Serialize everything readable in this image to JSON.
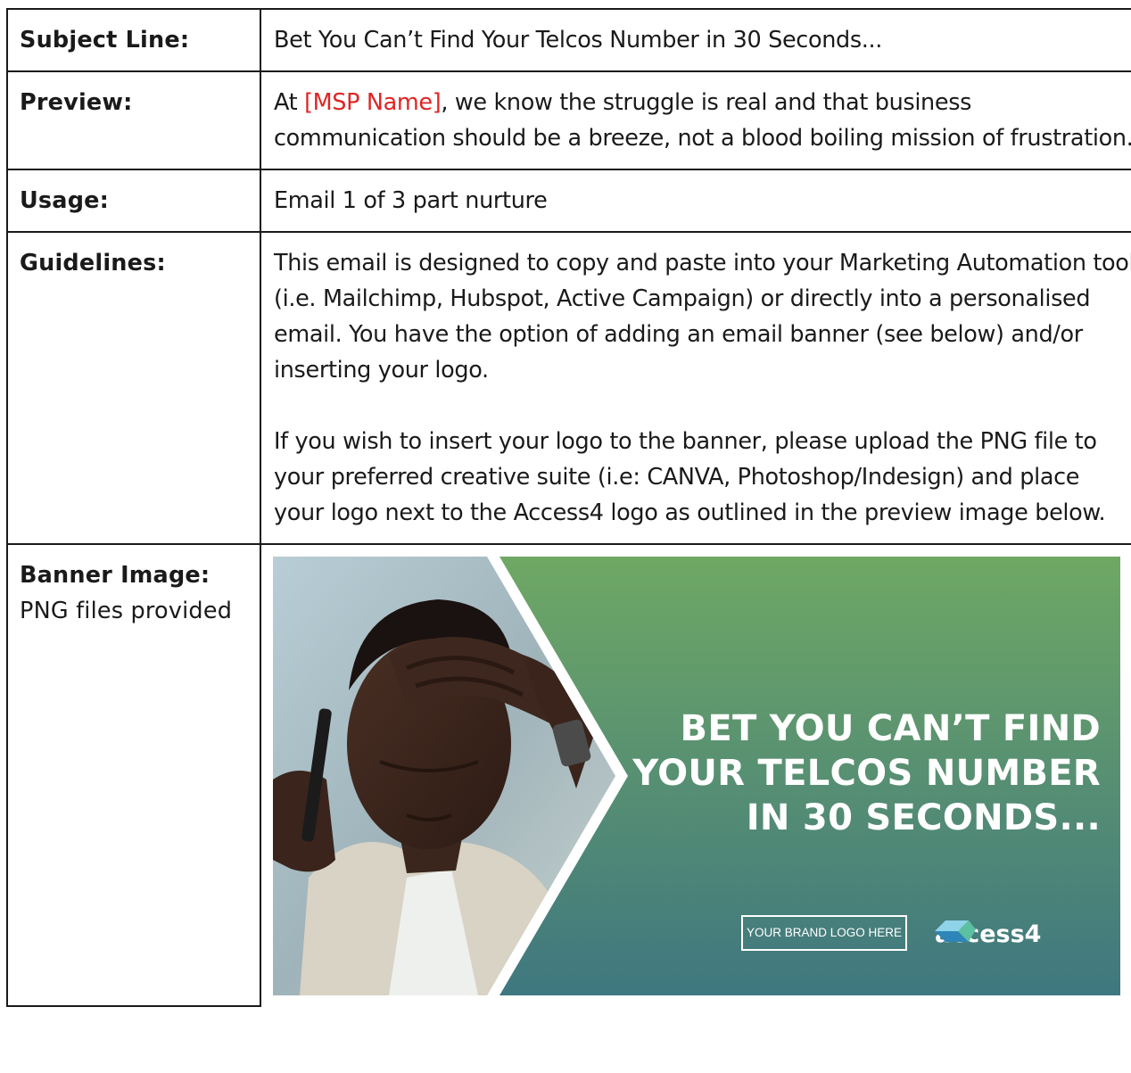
{
  "rows": {
    "subject": {
      "label": "Subject Line:",
      "value": "Bet You Can’t Find Your Telcos Number in 30 Seconds..."
    },
    "preview": {
      "label": "Preview:",
      "prefix": "At ",
      "placeholder": "[MSP Name]",
      "suffix": ", we know the struggle is real and that business communication should be a breeze, not a blood boiling mission of frustration."
    },
    "usage": {
      "label": "Usage:",
      "value": "Email 1 of 3 part nurture"
    },
    "guidelines": {
      "label": "Guidelines:",
      "paragraph_1": "This email is designed to copy and paste into your Marketing Automation tool (i.e. Mailchimp, Hubspot, Active Campaign) or directly into a personalised email. You have the option of adding an email banner (see below) and/or inserting your logo.",
      "paragraph_2": "If you wish to insert your logo to the banner, please upload the PNG file to your preferred creative suite (i.e: CANVA, Photoshop/Indesign) and place your logo next to the Access4 logo as outlined in the preview image below."
    },
    "banner": {
      "label": "Banner Image:",
      "sublabel": "PNG files provided"
    }
  },
  "banner": {
    "headline_line_1": "BET YOU CAN’T FIND",
    "headline_line_2": "YOUR TELCOS NUMBER",
    "headline_line_3": "IN 30 SECONDS...",
    "brand_placeholder": "YOUR BRAND LOGO HERE",
    "logo_text": "access4",
    "gradient_top": "#6fa864",
    "gradient_bottom": "#3f7780",
    "placeholder_color": "#e02424"
  }
}
